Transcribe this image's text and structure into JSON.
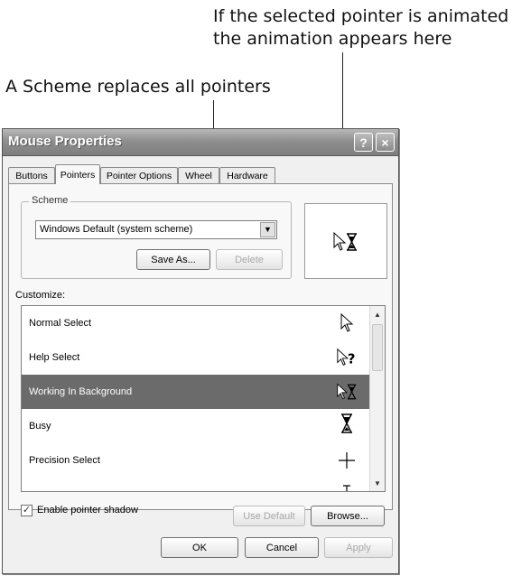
{
  "callouts": {
    "animation_line1": "If the selected pointer is animated",
    "animation_line2": "the animation appears here",
    "scheme": "A Scheme replaces all pointers"
  },
  "window": {
    "title": "Mouse Properties",
    "help_button": "?",
    "close_button": "×"
  },
  "tabs": [
    "Buttons",
    "Pointers",
    "Pointer Options",
    "Wheel",
    "Hardware"
  ],
  "active_tab": "Pointers",
  "scheme": {
    "legend": "Scheme",
    "selected": "Windows Default (system scheme)",
    "save_as": "Save As...",
    "delete": "Delete"
  },
  "customize": {
    "label": "Customize:",
    "items": [
      {
        "label": "Normal Select",
        "icon": "arrow-cursor-icon"
      },
      {
        "label": "Help Select",
        "icon": "help-cursor-icon"
      },
      {
        "label": "Working In Background",
        "icon": "working-cursor-icon"
      },
      {
        "label": "Busy",
        "icon": "hourglass-icon"
      },
      {
        "label": "Precision Select",
        "icon": "crosshair-icon"
      },
      {
        "label": "",
        "icon": "text-select-icon"
      }
    ],
    "selected_index": 2
  },
  "shadow": {
    "label": "Enable pointer shadow",
    "checked": true
  },
  "buttons": {
    "use_default": "Use Default",
    "browse": "Browse...",
    "ok": "OK",
    "cancel": "Cancel",
    "apply": "Apply"
  },
  "colors": {
    "titlebar": "#8f8f8f",
    "selection": "#6b6b6b"
  }
}
